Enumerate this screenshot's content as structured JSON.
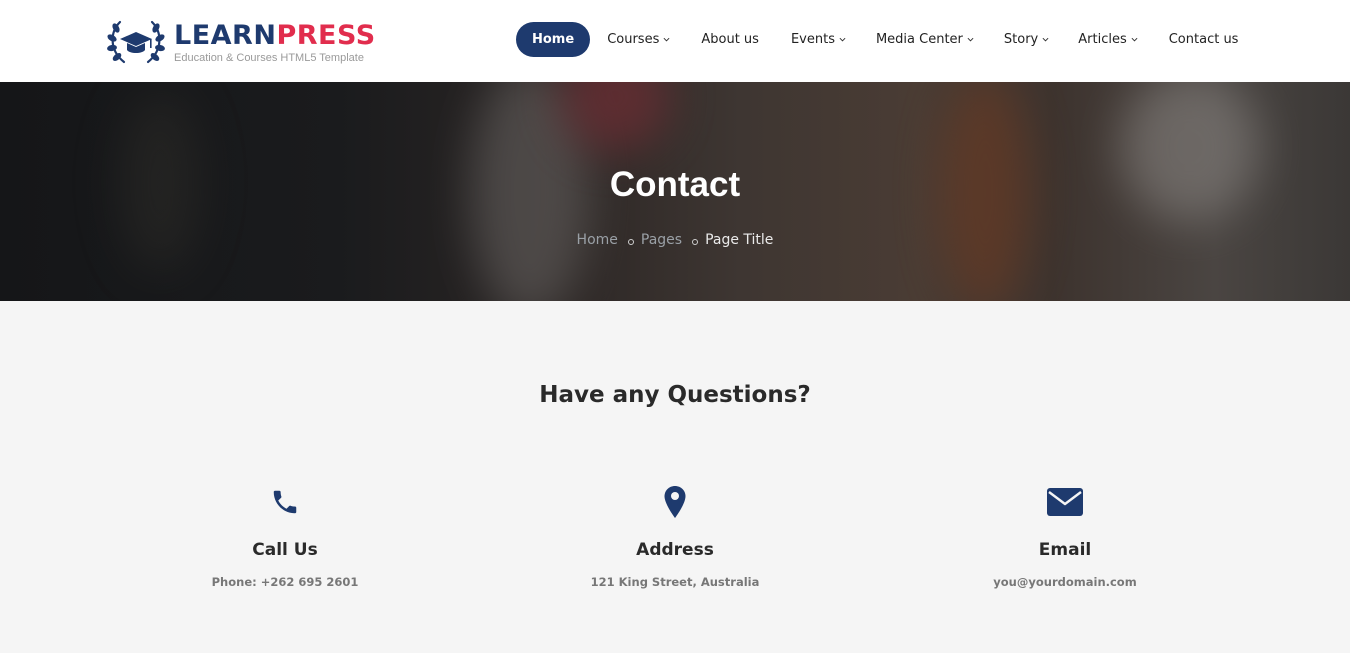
{
  "brand": {
    "name_part1": "LEARN",
    "name_part2": "PRESS",
    "tagline": "Education & Courses HTML5 Template",
    "color_primary": "#1e3a6e",
    "color_accent": "#e12d4d"
  },
  "nav": {
    "items": [
      {
        "label": "Home",
        "active": true,
        "dropdown": false
      },
      {
        "label": "Courses",
        "active": false,
        "dropdown": true
      },
      {
        "label": "About us",
        "active": false,
        "dropdown": false
      },
      {
        "label": "Events",
        "active": false,
        "dropdown": true
      },
      {
        "label": "Media Center",
        "active": false,
        "dropdown": true
      },
      {
        "label": "Story",
        "active": false,
        "dropdown": true
      },
      {
        "label": "Articles",
        "active": false,
        "dropdown": true
      },
      {
        "label": "Contact us",
        "active": false,
        "dropdown": false
      }
    ]
  },
  "hero": {
    "title": "Contact",
    "breadcrumb": [
      "Home",
      "Pages",
      "Page Title"
    ]
  },
  "contact": {
    "heading": "Have any Questions?",
    "cards": [
      {
        "icon": "phone-icon",
        "title": "Call Us",
        "detail": "Phone: +262 695 2601"
      },
      {
        "icon": "map-pin-icon",
        "title": "Address",
        "detail": "121 King Street, Australia"
      },
      {
        "icon": "envelope-icon",
        "title": "Email",
        "detail": "you@yourdomain.com"
      }
    ]
  }
}
